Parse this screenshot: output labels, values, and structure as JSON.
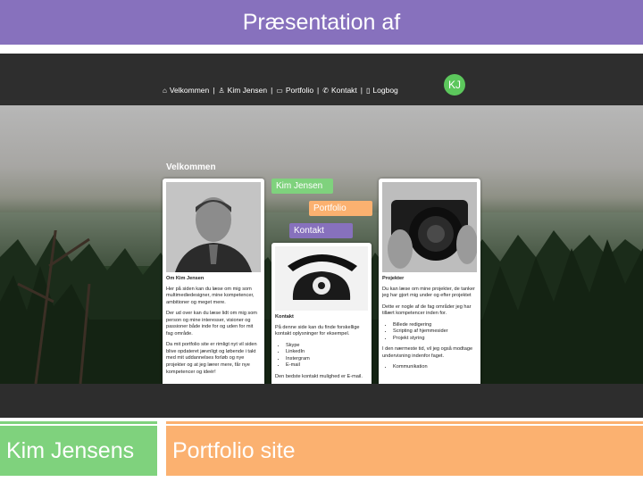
{
  "slide": {
    "title": "Præsentation af",
    "footer_left": "Kim Jensens",
    "footer_right": "Portfolio site",
    "colors": {
      "purple": "#8771bd",
      "green": "#7fd27d",
      "orange": "#fbb170"
    }
  },
  "site": {
    "nav": [
      {
        "icon": "home-icon",
        "label": "Velkommen"
      },
      {
        "icon": "user-icon",
        "label": "Kim Jensen"
      },
      {
        "icon": "briefcase-icon",
        "label": "Portfolio"
      },
      {
        "icon": "phone-icon",
        "label": "Kontakt"
      },
      {
        "icon": "book-icon",
        "label": "Logbog"
      }
    ],
    "logo": "KJ",
    "section_title": "Velkommen",
    "tags": {
      "kim": "Kim Jensen",
      "portfolio": "Portfolio",
      "kontakt": "Kontakt"
    },
    "card_about": {
      "heading": "Om Kim Jensen",
      "p1": "Her på siden kan du læse om mig som multimediedesigner, mine kompetencer, ambitioner og meget mere.",
      "p2": "Der ud over kan du læse lidt om mig som person og mine interesser, visioner og passioner både inde for og uden for mit fag område.",
      "p3": "Da mit portfolio site er rimligt nyt vil siden blive opdateret jævnligt og løbende i takt med mit uddannelses forløb og nye projekter og at jeg lærer mere, får nye kompetencer og ideér!"
    },
    "card_contact": {
      "heading": "Kontakt",
      "p1": "På denne side kan du finde forskellige kontakt oplysninger for eksempel.",
      "items": [
        "Skype",
        "LinkedIn",
        "Instergram",
        "E-mail"
      ],
      "p2": "Den bedste kontakt mulighed er E-mail."
    },
    "card_projects": {
      "heading": "Projekter",
      "p1": "Du kan læse om mine projekter, de tanker jeg har gjort mig under og efter projektet",
      "p2": "Dette er nogle af de fag områder jeg har tillært kompetencer inden for.",
      "items": [
        "Billede redigering",
        "Scripting af hjemmesider",
        "Projekt styring"
      ],
      "p3": "I den nærmeste tid, vil jeg også modtage undervisning indenfor faget.",
      "items2": [
        "Kommunikation"
      ]
    }
  }
}
